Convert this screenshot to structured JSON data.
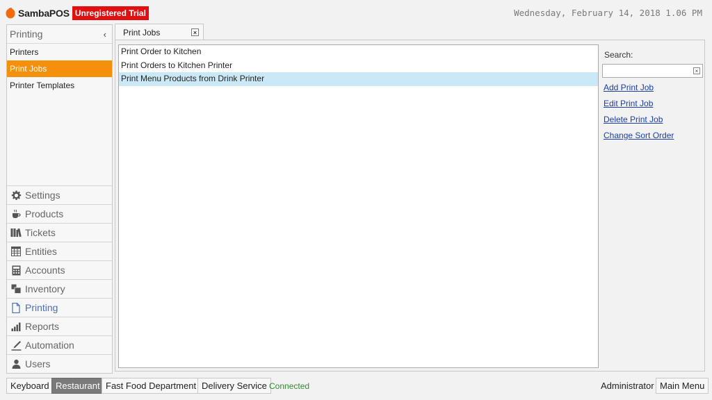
{
  "header": {
    "app_name": "SambaPOS",
    "trial_badge": "Unregistered Trial",
    "clock": "Wednesday, February 14, 2018 1.06 PM"
  },
  "nav": {
    "section_title": "Printing",
    "collapse_glyph": "‹",
    "sub_items": [
      {
        "label": "Printers",
        "active": false
      },
      {
        "label": "Print Jobs",
        "active": true
      },
      {
        "label": "Printer Templates",
        "active": false
      }
    ],
    "modules": [
      {
        "label": "Settings",
        "icon": "gear-icon"
      },
      {
        "label": "Products",
        "icon": "coffee-cup-icon"
      },
      {
        "label": "Tickets",
        "icon": "books-icon"
      },
      {
        "label": "Entities",
        "icon": "table-icon"
      },
      {
        "label": "Accounts",
        "icon": "calculator-icon"
      },
      {
        "label": "Inventory",
        "icon": "boxes-icon"
      },
      {
        "label": "Printing",
        "icon": "document-icon",
        "active": true
      },
      {
        "label": "Reports",
        "icon": "bar-chart-icon"
      },
      {
        "label": "Automation",
        "icon": "pen-icon"
      },
      {
        "label": "Users",
        "icon": "user-icon"
      }
    ]
  },
  "tab": {
    "label": "Print Jobs",
    "close_glyph": "×"
  },
  "jobs": [
    {
      "name": "Print Order to Kitchen",
      "selected": false
    },
    {
      "name": "Print Orders to Kitchen Printer",
      "selected": false
    },
    {
      "name": "Print Menu Products from Drink Printer",
      "selected": true
    }
  ],
  "side": {
    "search_label": "Search:",
    "search_value": "",
    "clear_glyph": "×",
    "actions": [
      "Add Print Job",
      "Edit Print Job",
      "Delete Print Job",
      "Change Sort Order"
    ]
  },
  "bottom": {
    "keyboard": "Keyboard",
    "restaurant": "Restaurant",
    "fast_food": "Fast Food Department",
    "delivery": "Delivery Service",
    "status": "Connected",
    "user": "Administrator",
    "main_menu": "Main Menu"
  },
  "colors": {
    "accent_orange": "#f4900c",
    "trial_red": "#e01010",
    "selection_blue": "#cbe8f6",
    "link_blue": "#1a3ea8",
    "status_green": "#2d8e2d"
  }
}
